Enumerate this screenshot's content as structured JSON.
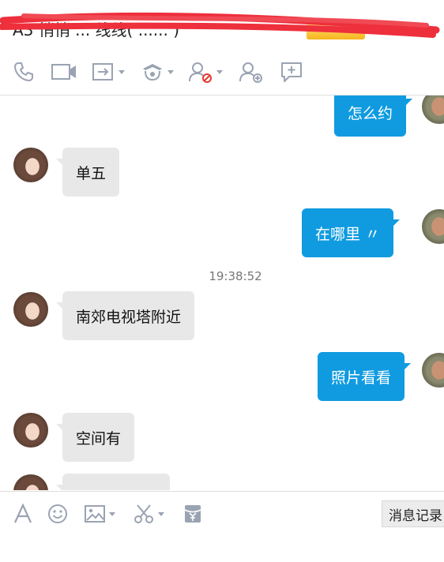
{
  "window": {
    "title_visible": "A3 悄悄 ... 线线( ...... )"
  },
  "toolbar": {
    "items": [
      {
        "icon": "phone-icon"
      },
      {
        "icon": "video-camera-icon"
      },
      {
        "icon": "file-transfer-icon",
        "dropdown": true
      },
      {
        "icon": "app-store-icon",
        "dropdown": true
      },
      {
        "icon": "block-contact-icon",
        "dropdown": true
      },
      {
        "icon": "add-friend-icon"
      },
      {
        "icon": "feedback-icon"
      }
    ]
  },
  "conversation": {
    "messages": [
      {
        "side": "out",
        "text": "怎么约"
      },
      {
        "side": "in",
        "text": "单五"
      },
      {
        "side": "out",
        "text": "在哪里 〃"
      },
      {
        "type": "timestamp",
        "text": "19:38:52"
      },
      {
        "side": "in",
        "text": "南郊电视塔附近"
      },
      {
        "side": "out",
        "text": "照片看看"
      },
      {
        "side": "in",
        "text": "空间有"
      },
      {
        "side": "in",
        "text": ""
      }
    ]
  },
  "input_toolbar": {
    "history_label": "消息记录",
    "items": [
      {
        "icon": "font-icon"
      },
      {
        "icon": "emoji-icon"
      },
      {
        "icon": "image-icon",
        "dropdown": true
      },
      {
        "icon": "screenshot-scissors-icon",
        "dropdown": true
      },
      {
        "icon": "red-packet-icon"
      }
    ]
  },
  "colors": {
    "outgoing_bubble": "#109be0",
    "incoming_bubble": "#e8e8e8",
    "icon_gray": "#9aa3b2",
    "redaction_red": "#ee2f3c"
  }
}
